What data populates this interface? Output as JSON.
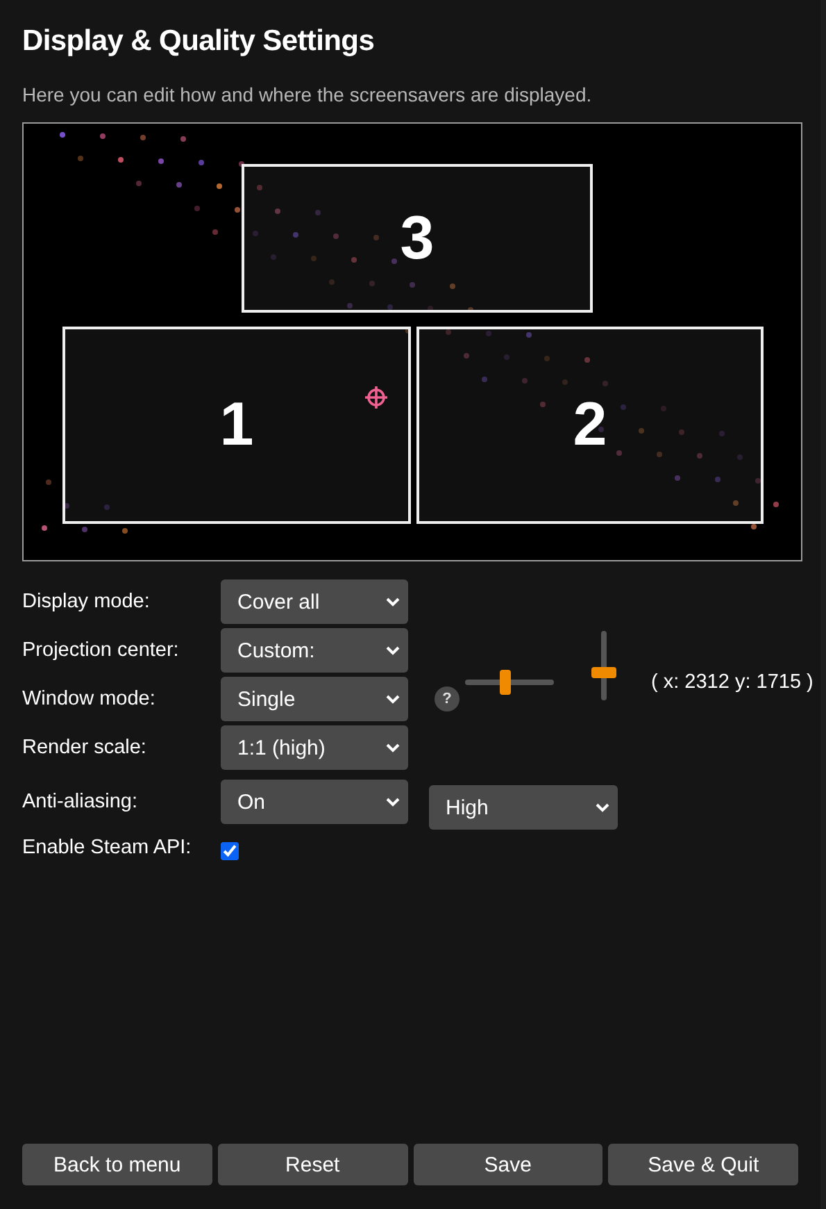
{
  "title": "Display & Quality Settings",
  "description": "Here you can edit how and where the screensavers are displayed.",
  "preview": {
    "monitors": [
      {
        "number": "3",
        "kind": "top"
      },
      {
        "number": "1",
        "kind": "left"
      },
      {
        "number": "2",
        "kind": "right"
      }
    ]
  },
  "settings": [
    {
      "kind": "select",
      "label": "Display mode:",
      "value": "Cover all"
    },
    {
      "kind": "select",
      "label": "Projection center:",
      "value": "Custom:"
    },
    {
      "kind": "select",
      "label": "Window mode:",
      "value": "Single",
      "help": "?"
    },
    {
      "kind": "select",
      "label": "Render scale:",
      "value": "1:1 (high)"
    },
    {
      "kind": "select",
      "label": "Anti-aliasing:",
      "value": "On",
      "extra_value": "High"
    },
    {
      "kind": "checkbox",
      "label": "Enable Steam API:",
      "checked": true
    }
  ],
  "projection": {
    "horizontal": {
      "level": 0.45
    },
    "vertical": {
      "level": 0.4
    },
    "reading": "( x: 2312 y: 1715 )"
  },
  "buttons": [
    "Back to menu",
    "Reset",
    "Save",
    "Save & Quit"
  ]
}
